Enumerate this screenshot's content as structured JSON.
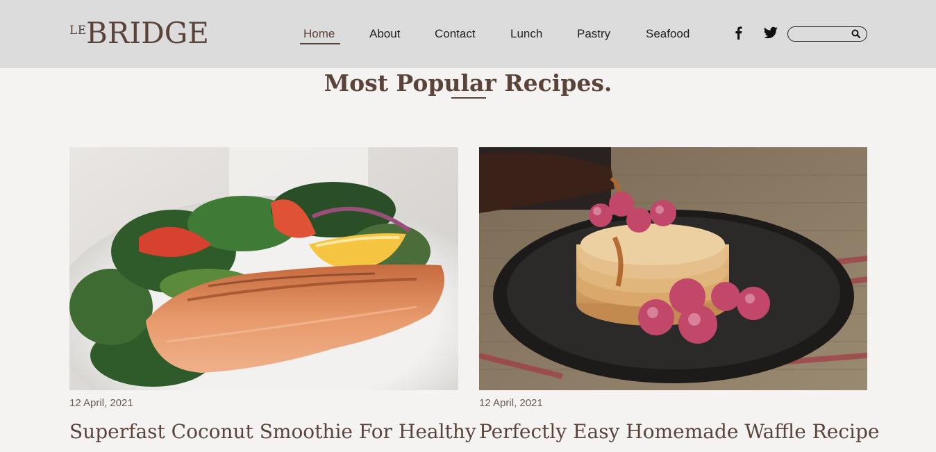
{
  "header": {
    "logo_prefix": "LE",
    "logo_main": "BRIDGE",
    "nav": [
      {
        "label": "Home",
        "active": true
      },
      {
        "label": "About",
        "active": false
      },
      {
        "label": "Contact",
        "active": false
      },
      {
        "label": "Lunch",
        "active": false
      },
      {
        "label": "Pastry",
        "active": false
      },
      {
        "label": "Seafood",
        "active": false
      }
    ],
    "social": [
      "facebook-icon",
      "twitter-icon"
    ],
    "search": {
      "placeholder": "",
      "value": ""
    }
  },
  "section": {
    "title": "Most Popular Recipes."
  },
  "cards": [
    {
      "date": "12 April, 2021",
      "title": "Superfast Coconut Smoothie For Healthy",
      "image": "salmon-salad-photo"
    },
    {
      "date": "12 April, 2021",
      "title": "Perfectly Easy Homemade Waffle Recipe",
      "image": "pancakes-raspberries-photo"
    }
  ],
  "colors": {
    "header_bg": "#dddcdc",
    "page_bg": "#f4f3f2",
    "brand": "#5a4338"
  }
}
